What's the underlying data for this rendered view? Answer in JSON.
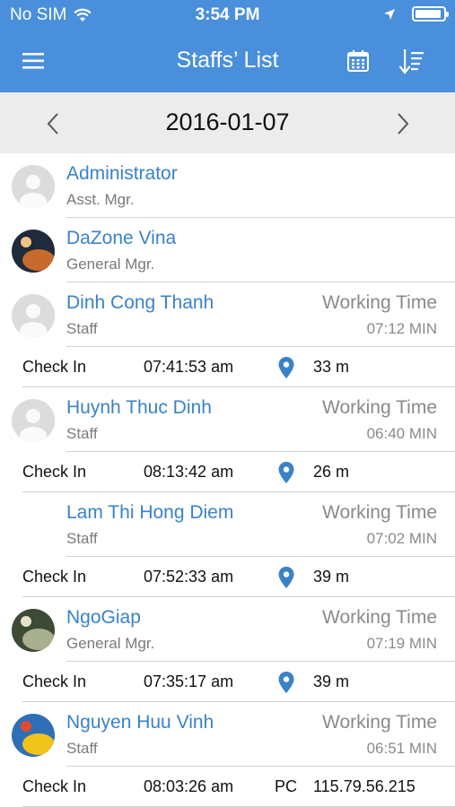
{
  "status_bar": {
    "carrier": "No SIM",
    "time": "3:54 PM"
  },
  "nav": {
    "title": "Staffs’ List"
  },
  "date_bar": {
    "date": "2016-01-07"
  },
  "colors": {
    "accent": "#4a8fdb",
    "name_link": "#3a82c8",
    "pin": "#3a82c8"
  },
  "staff": [
    {
      "name": "Administrator",
      "role": "Asst. Mgr.",
      "avatar": "default-avatar"
    },
    {
      "name": "DaZone Vina",
      "role": "General Mgr.",
      "avatar": "photo-avatar"
    },
    {
      "name": "Dinh Cong Thanh",
      "role": "Staff",
      "avatar": "default-avatar",
      "working_label": "Working Time",
      "working_value": "07:12 MIN",
      "checkin_label": "Check In",
      "checkin_time": "07:41:53 am",
      "checkin_type": "location",
      "checkin_detail": "33 m"
    },
    {
      "name": "Huynh Thuc Dinh",
      "role": "Staff",
      "avatar": "default-avatar",
      "working_label": "Working Time",
      "working_value": "06:40 MIN",
      "checkin_label": "Check In",
      "checkin_time": "08:13:42 am",
      "checkin_type": "location",
      "checkin_detail": "26 m"
    },
    {
      "name": "Lam Thi Hong Diem",
      "role": "Staff",
      "avatar": "none",
      "working_label": "Working Time",
      "working_value": "07:02 MIN",
      "checkin_label": "Check In",
      "checkin_time": "07:52:33 am",
      "checkin_type": "location",
      "checkin_detail": "39 m"
    },
    {
      "name": "NgoGiap",
      "role": "General Mgr.",
      "avatar": "photo-avatar",
      "working_label": "Working Time",
      "working_value": "07:19 MIN",
      "checkin_label": "Check In",
      "checkin_time": "07:35:17 am",
      "checkin_type": "location",
      "checkin_detail": "39 m"
    },
    {
      "name": "Nguyen Huu Vinh",
      "role": "Staff",
      "avatar": "photo-avatar",
      "working_label": "Working Time",
      "working_value": "06:51 MIN",
      "checkin_label": "Check In",
      "checkin_time": "08:03:26 am",
      "checkin_type": "pc",
      "checkin_type_label": "PC",
      "checkin_detail": "115.79.56.215"
    }
  ]
}
